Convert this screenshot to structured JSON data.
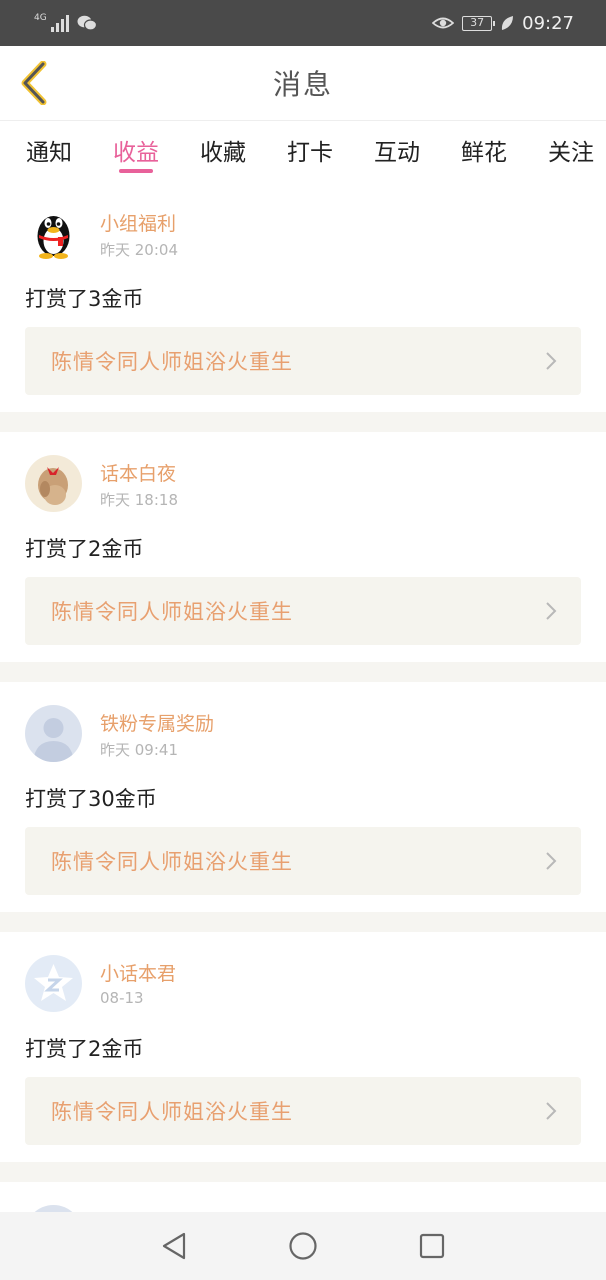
{
  "status_bar": {
    "network": "4G",
    "battery": "37",
    "time": "09:27",
    "icons": [
      "signal-icon",
      "wechat-icon",
      "eye-icon",
      "battery-icon",
      "leaf-icon"
    ]
  },
  "header": {
    "title": "消息"
  },
  "tabs": [
    {
      "label": "通知",
      "active": false
    },
    {
      "label": "收益",
      "active": true
    },
    {
      "label": "收藏",
      "active": false
    },
    {
      "label": "打卡",
      "active": false
    },
    {
      "label": "互动",
      "active": false
    },
    {
      "label": "鲜花",
      "active": false
    },
    {
      "label": "关注",
      "active": false
    }
  ],
  "messages": [
    {
      "user": "小组福利",
      "time": "昨天 20:04",
      "action": "打赏了3金币",
      "link": "陈情令同人师姐浴火重生",
      "avatar": "penguin-avatar"
    },
    {
      "user": "话本白夜",
      "time": "昨天 18:18",
      "action": "打赏了2金币",
      "link": "陈情令同人师姐浴火重生",
      "avatar": "photo-avatar"
    },
    {
      "user": "铁粉专属奖励",
      "time": "昨天 09:41",
      "action": "打赏了30金币",
      "link": "陈情令同人师姐浴火重生",
      "avatar": "default-avatar"
    },
    {
      "user": "小话本君",
      "time": "08-13",
      "action": "打赏了2金币",
      "link": "陈情令同人师姐浴火重生",
      "avatar": "star-avatar"
    }
  ],
  "colors": {
    "accent": "#e8619a",
    "username": "#e7a06b",
    "link": "#e8a070"
  }
}
